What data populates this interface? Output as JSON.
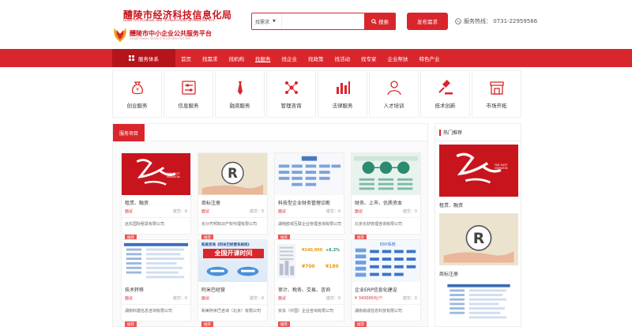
{
  "logo": {
    "title": "醴陵市经济科技信息化局",
    "title_en": "LILING CITY ECONOMIC AND TECHNOLOGICAL INFORMATION TECHNOLOGY BUREAU",
    "sub": "醴陵市中小企业公共服务平台",
    "sub_en": "LILING PUBLIC SERVICE PLATFORM FOR SME"
  },
  "search": {
    "select": "找需求",
    "placeholder": "",
    "button": "搜索"
  },
  "publish": "发布需求",
  "hotline": "服务热线：  0731-22959566",
  "nav": {
    "system": "服务体系",
    "items": [
      "首页",
      "找需求",
      "找机构",
      "找服务",
      "找企业",
      "找政策",
      "找活动",
      "找专家",
      "企业帮扶",
      "特色产业"
    ],
    "active": 3
  },
  "categories": [
    {
      "label": "创业服务",
      "icon": "money-bag-icon"
    },
    {
      "label": "信息服务",
      "icon": "sliders-icon"
    },
    {
      "label": "融资服务",
      "icon": "tie-icon"
    },
    {
      "label": "管理咨询",
      "icon": "network-icon"
    },
    {
      "label": "法律服务",
      "icon": "bar-chart-icon"
    },
    {
      "label": "人才培训",
      "icon": "people-icon"
    },
    {
      "label": "技术创新",
      "icon": "gavel-icon"
    },
    {
      "label": "市场开拓",
      "icon": "storefront-icon"
    }
  ],
  "section_title": "服务项目",
  "cards": [
    {
      "title": "租赁、融资",
      "price": "面议",
      "deals": "成交：0",
      "company": "远东国际租赁有限公司",
      "tag": "推荐",
      "img": "fareast"
    },
    {
      "title": "商标注册",
      "price": "面议",
      "deals": "成交：0",
      "company": "长沙齐邦知识产权代理有限公司",
      "tag": "推荐",
      "img": "trademark"
    },
    {
      "title": "科技型企业财务管理诊断",
      "price": "面议",
      "deals": "成交：0",
      "company": "湖南欧城互联企业管理咨询有限公司",
      "tag": "推荐",
      "img": "orgchart"
    },
    {
      "title": "财务、上市、优质资本",
      "price": "面议",
      "deals": "成交：0",
      "company": "北京长财管理咨询有限公司",
      "tag": "推荐",
      "img": "finance"
    },
    {
      "title": "技术转移",
      "price": "面议",
      "deals": "成交：0",
      "company": "湖南科建信息咨询有限公司",
      "tag": "推荐",
      "img": "techdoc"
    },
    {
      "title": "阿米巴经营",
      "price": "面议",
      "deals": "成交：0",
      "company": "和美阿米巴咨询（北京）有限公司",
      "tag": "推荐",
      "img": "amoeba"
    },
    {
      "title": "审计、税务、交易、咨询",
      "price": "面议",
      "deals": "成交：0",
      "company": "安永（中国）企业咨询有限公司",
      "tag": "推荐",
      "img": "audit"
    },
    {
      "title": "企业ERP信息化建设",
      "price": "¥ 343000元/个",
      "deals": "成交：0",
      "company": "湖南易成信息科技有限公司",
      "tag": "推荐",
      "img": "erp"
    }
  ],
  "side": {
    "title": "热门推荐",
    "items": [
      {
        "caption": "租赁、融资"
      },
      {
        "caption": "商标注册"
      }
    ]
  },
  "img_text": {
    "fareast_en": "FAR EAST HORIZON",
    "amoeba_title": "和美咨询《阿米巴经营系统班》",
    "amoeba_big": "全国开课时间",
    "audit_n1": "¥240,000",
    "audit_n2": "+6.2%",
    "audit_n3": "¥700",
    "audit_n4": "¥180",
    "erp_title": "ERP系统"
  },
  "colors": {
    "brand": "#d9262c",
    "brand_dark": "#b5141a"
  }
}
